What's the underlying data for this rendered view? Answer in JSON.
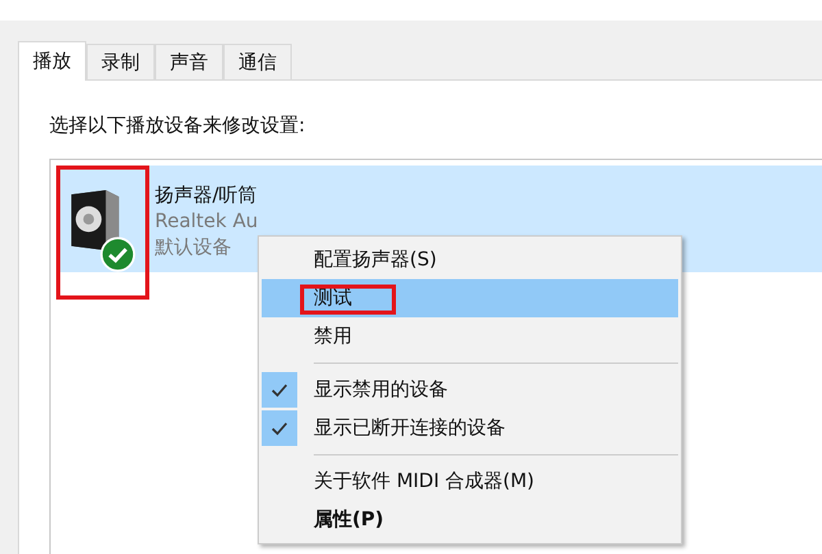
{
  "tabs": [
    {
      "label": "播放",
      "selected": true
    },
    {
      "label": "录制",
      "selected": false
    },
    {
      "label": "声音",
      "selected": false
    },
    {
      "label": "通信",
      "selected": false
    }
  ],
  "instruction": "选择以下播放设备来修改设置:",
  "devices": [
    {
      "name": "扬声器/听筒",
      "driver": "Realtek Au",
      "status": "默认设备",
      "selected": true,
      "default": true,
      "annotated": true
    }
  ],
  "context_menu": [
    {
      "kind": "item",
      "label": "配置扬声器(S)",
      "selected": false,
      "checked": false,
      "bold": false,
      "annotated": false
    },
    {
      "kind": "item",
      "label": "测试",
      "selected": true,
      "checked": false,
      "bold": false,
      "annotated": true
    },
    {
      "kind": "item",
      "label": "禁用",
      "selected": false,
      "checked": false,
      "bold": false,
      "annotated": false
    },
    {
      "kind": "separator"
    },
    {
      "kind": "item",
      "label": "显示禁用的设备",
      "selected": false,
      "checked": true,
      "bold": false,
      "annotated": false
    },
    {
      "kind": "item",
      "label": "显示已断开连接的设备",
      "selected": false,
      "checked": true,
      "bold": false,
      "annotated": false
    },
    {
      "kind": "separator"
    },
    {
      "kind": "item",
      "label": "关于软件 MIDI 合成器(M)",
      "selected": false,
      "checked": false,
      "bold": false,
      "annotated": false
    },
    {
      "kind": "item",
      "label": "属性(P)",
      "selected": false,
      "checked": false,
      "bold": true,
      "annotated": false
    }
  ]
}
